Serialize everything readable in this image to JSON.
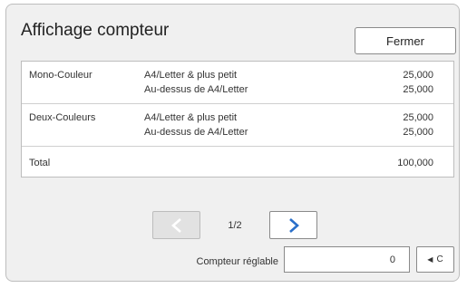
{
  "dialog": {
    "title": "Affichage compteur",
    "close_label": "Fermer"
  },
  "table": {
    "groups": [
      {
        "label": "Mono-Couleur",
        "rows": [
          {
            "size": "A4/Letter & plus petit",
            "value": "25,000"
          },
          {
            "size": "Au-dessus de A4/Letter",
            "value": "25,000"
          }
        ]
      },
      {
        "label": "Deux-Couleurs",
        "rows": [
          {
            "size": "A4/Letter & plus petit",
            "value": "25,000"
          },
          {
            "size": "Au-dessus de A4/Letter",
            "value": "25,000"
          }
        ]
      }
    ],
    "total": {
      "label": "Total",
      "value": "100,000"
    }
  },
  "pagination": {
    "page": "1/2",
    "prev_icon": "chevron-left-icon",
    "next_icon": "chevron-right-icon",
    "next_color": "#2a6fc9",
    "prev_color": "#ffffff"
  },
  "counter": {
    "label": "Compteur réglable",
    "value": "0",
    "clear_label": "C",
    "clear_icon": "triangle-left-icon"
  }
}
